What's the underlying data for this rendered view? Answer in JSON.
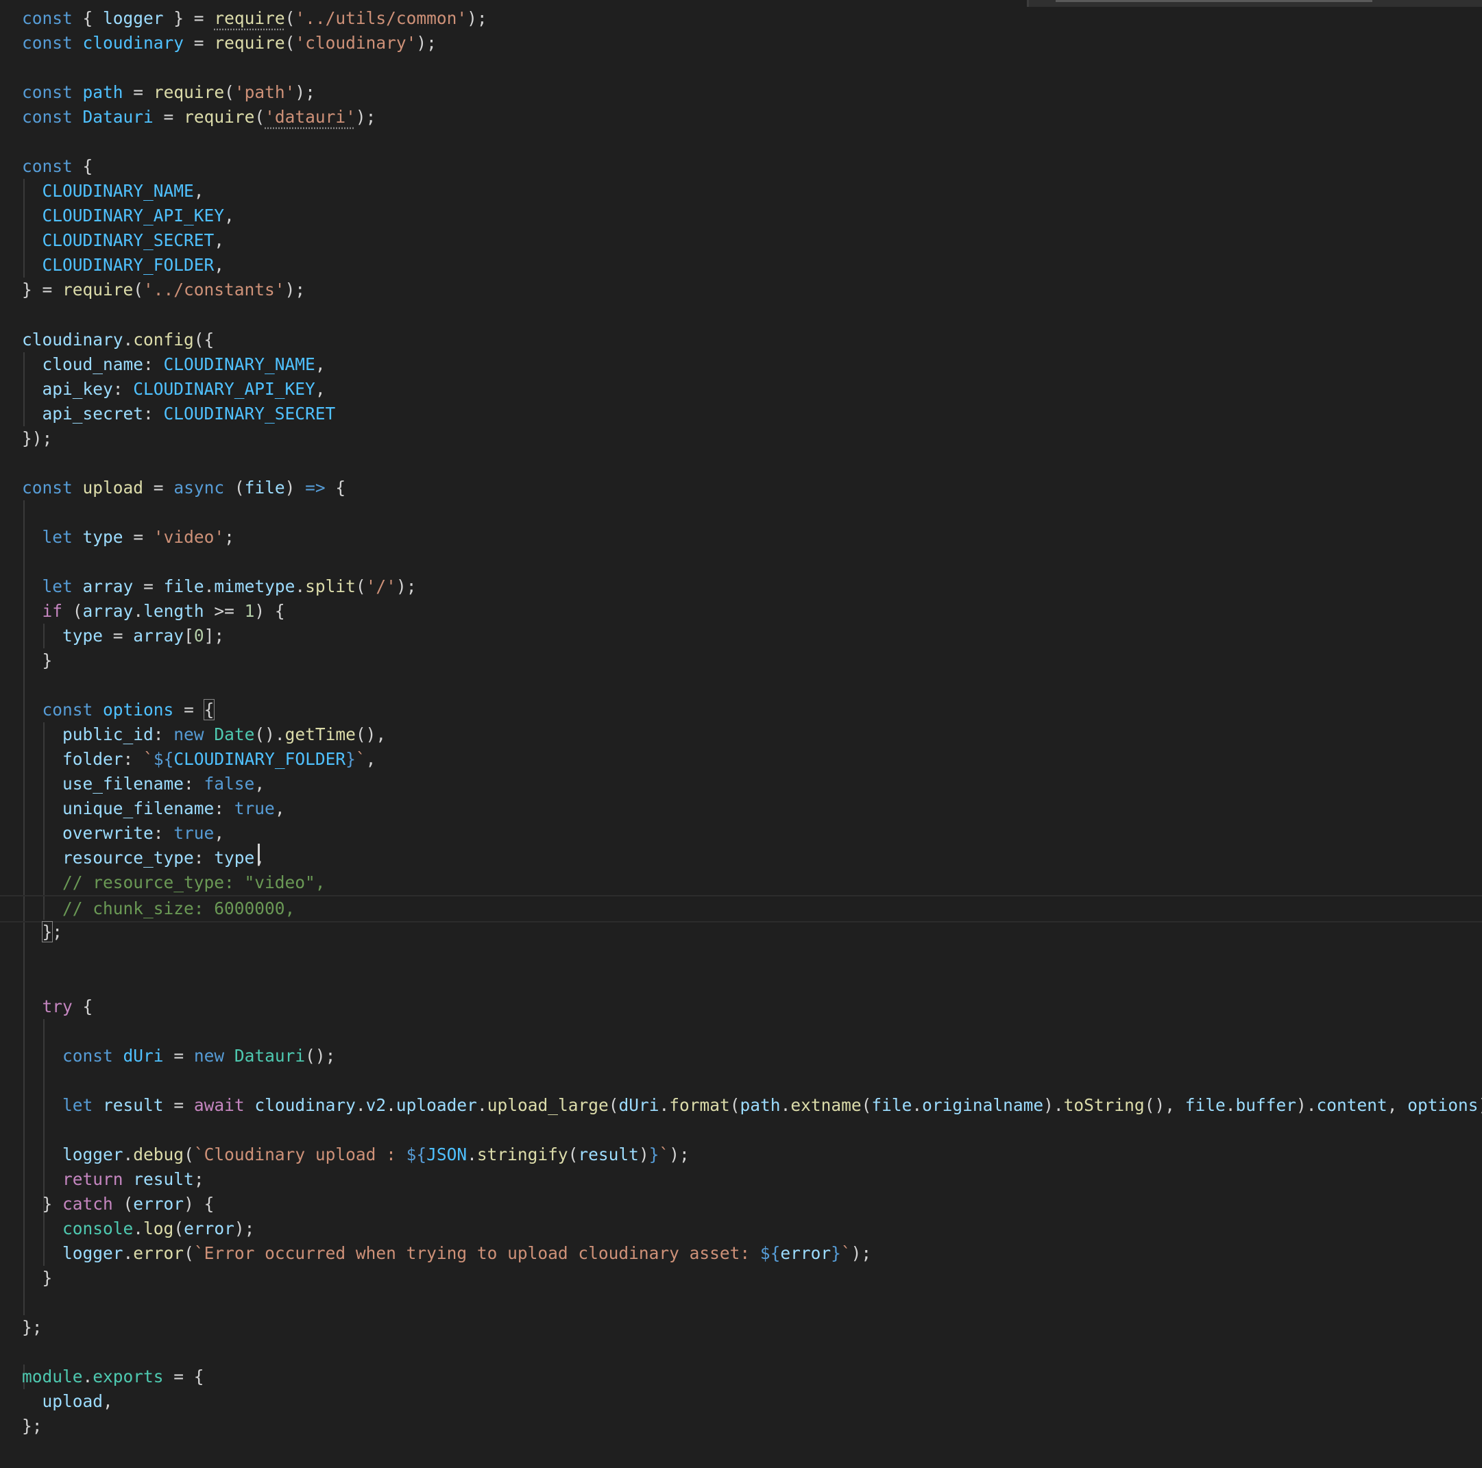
{
  "editor": {
    "language": "javascript",
    "theme_colors": {
      "background": "#1f1f1f",
      "keyword": "#569cd6",
      "control": "#c586c0",
      "function": "#dcdcaa",
      "string": "#ce9178",
      "variable": "#9cdcfe",
      "constant": "#4fc1ff",
      "number": "#b5cea8",
      "type": "#4ec9b0",
      "comment": "#6a9955"
    },
    "cursor": {
      "line": 36,
      "column": 27
    },
    "lines": [
      [
        [
          "kw",
          "const"
        ],
        [
          "pun",
          " { "
        ],
        [
          "var",
          "logger"
        ],
        [
          "pun",
          " } = "
        ],
        [
          "fn",
          "require",
          "dots"
        ],
        [
          "pun",
          "("
        ],
        [
          "str",
          "'../utils/common'"
        ],
        [
          "pun",
          ");"
        ]
      ],
      [
        [
          "kw",
          "const"
        ],
        [
          "pun",
          " "
        ],
        [
          "const",
          "cloudinary"
        ],
        [
          "pun",
          " = "
        ],
        [
          "fn",
          "require"
        ],
        [
          "pun",
          "("
        ],
        [
          "str",
          "'cloudinary'"
        ],
        [
          "pun",
          ");"
        ]
      ],
      [],
      [
        [
          "kw",
          "const"
        ],
        [
          "pun",
          " "
        ],
        [
          "const",
          "path"
        ],
        [
          "pun",
          " = "
        ],
        [
          "fn",
          "require"
        ],
        [
          "pun",
          "("
        ],
        [
          "str",
          "'path'"
        ],
        [
          "pun",
          ");"
        ]
      ],
      [
        [
          "kw",
          "const"
        ],
        [
          "pun",
          " "
        ],
        [
          "const",
          "Datauri"
        ],
        [
          "pun",
          " = "
        ],
        [
          "fn",
          "require"
        ],
        [
          "pun",
          "("
        ],
        [
          "str",
          "'datauri'",
          "dots"
        ],
        [
          "pun",
          ");"
        ]
      ],
      [],
      [
        [
          "kw",
          "const"
        ],
        [
          "pun",
          " {"
        ]
      ],
      [
        [
          "pun",
          "  "
        ],
        [
          "const",
          "CLOUDINARY_NAME"
        ],
        [
          "pun",
          ","
        ]
      ],
      [
        [
          "pun",
          "  "
        ],
        [
          "const",
          "CLOUDINARY_API_KEY"
        ],
        [
          "pun",
          ","
        ]
      ],
      [
        [
          "pun",
          "  "
        ],
        [
          "const",
          "CLOUDINARY_SECRET"
        ],
        [
          "pun",
          ","
        ]
      ],
      [
        [
          "pun",
          "  "
        ],
        [
          "const",
          "CLOUDINARY_FOLDER"
        ],
        [
          "pun",
          ","
        ]
      ],
      [
        [
          "pun",
          "} = "
        ],
        [
          "fn",
          "require"
        ],
        [
          "pun",
          "("
        ],
        [
          "str",
          "'../constants'"
        ],
        [
          "pun",
          ");"
        ]
      ],
      [],
      [
        [
          "var",
          "cloudinary"
        ],
        [
          "pun",
          "."
        ],
        [
          "fn",
          "config"
        ],
        [
          "pun",
          "({"
        ]
      ],
      [
        [
          "pun",
          "  "
        ],
        [
          "var",
          "cloud_name"
        ],
        [
          "pun",
          ": "
        ],
        [
          "const",
          "CLOUDINARY_NAME"
        ],
        [
          "pun",
          ","
        ]
      ],
      [
        [
          "pun",
          "  "
        ],
        [
          "var",
          "api_key"
        ],
        [
          "pun",
          ": "
        ],
        [
          "const",
          "CLOUDINARY_API_KEY"
        ],
        [
          "pun",
          ","
        ]
      ],
      [
        [
          "pun",
          "  "
        ],
        [
          "var",
          "api_secret"
        ],
        [
          "pun",
          ": "
        ],
        [
          "const",
          "CLOUDINARY_SECRET"
        ]
      ],
      [
        [
          "pun",
          "});"
        ]
      ],
      [],
      [
        [
          "kw",
          "const"
        ],
        [
          "pun",
          " "
        ],
        [
          "fn",
          "upload"
        ],
        [
          "pun",
          " = "
        ],
        [
          "kw",
          "async"
        ],
        [
          "pun",
          " ("
        ],
        [
          "var",
          "file"
        ],
        [
          "pun",
          ") "
        ],
        [
          "kw",
          "=>"
        ],
        [
          "pun",
          " {"
        ]
      ],
      [],
      [
        [
          "pun",
          "  "
        ],
        [
          "kw",
          "let"
        ],
        [
          "pun",
          " "
        ],
        [
          "var",
          "type"
        ],
        [
          "pun",
          " = "
        ],
        [
          "str",
          "'video'"
        ],
        [
          "pun",
          ";"
        ]
      ],
      [],
      [
        [
          "pun",
          "  "
        ],
        [
          "kw",
          "let"
        ],
        [
          "pun",
          " "
        ],
        [
          "var",
          "array"
        ],
        [
          "pun",
          " = "
        ],
        [
          "var",
          "file"
        ],
        [
          "pun",
          "."
        ],
        [
          "var",
          "mimetype"
        ],
        [
          "pun",
          "."
        ],
        [
          "fn",
          "split"
        ],
        [
          "pun",
          "("
        ],
        [
          "str",
          "'/'"
        ],
        [
          "pun",
          ");"
        ]
      ],
      [
        [
          "pun",
          "  "
        ],
        [
          "ctl",
          "if"
        ],
        [
          "pun",
          " ("
        ],
        [
          "var",
          "array"
        ],
        [
          "pun",
          "."
        ],
        [
          "var",
          "length"
        ],
        [
          "pun",
          " >= "
        ],
        [
          "num",
          "1"
        ],
        [
          "pun",
          ") {"
        ]
      ],
      [
        [
          "pun",
          "    "
        ],
        [
          "var",
          "type"
        ],
        [
          "pun",
          " = "
        ],
        [
          "var",
          "array"
        ],
        [
          "pun",
          "["
        ],
        [
          "num",
          "0"
        ],
        [
          "pun",
          "];"
        ]
      ],
      [
        [
          "pun",
          "  }"
        ]
      ],
      [],
      [
        [
          "pun",
          "  "
        ],
        [
          "kw",
          "const"
        ],
        [
          "pun",
          " "
        ],
        [
          "const",
          "options"
        ],
        [
          "pun",
          " = "
        ],
        [
          "pun",
          "{",
          "box"
        ]
      ],
      [
        [
          "pun",
          "    "
        ],
        [
          "var",
          "public_id"
        ],
        [
          "pun",
          ": "
        ],
        [
          "kw",
          "new"
        ],
        [
          "pun",
          " "
        ],
        [
          "type",
          "Date"
        ],
        [
          "pun",
          "()."
        ],
        [
          "fn",
          "getTime"
        ],
        [
          "pun",
          "(),"
        ]
      ],
      [
        [
          "pun",
          "    "
        ],
        [
          "var",
          "folder"
        ],
        [
          "pun",
          ": "
        ],
        [
          "str",
          "`"
        ],
        [
          "kw",
          "${"
        ],
        [
          "const",
          "CLOUDINARY_FOLDER"
        ],
        [
          "kw",
          "}"
        ],
        [
          "str",
          "`"
        ],
        [
          "pun",
          ","
        ]
      ],
      [
        [
          "pun",
          "    "
        ],
        [
          "var",
          "use_filename"
        ],
        [
          "pun",
          ": "
        ],
        [
          "kw",
          "false"
        ],
        [
          "pun",
          ","
        ]
      ],
      [
        [
          "pun",
          "    "
        ],
        [
          "var",
          "unique_filename"
        ],
        [
          "pun",
          ": "
        ],
        [
          "kw",
          "true"
        ],
        [
          "pun",
          ","
        ]
      ],
      [
        [
          "pun",
          "    "
        ],
        [
          "var",
          "overwrite"
        ],
        [
          "pun",
          ": "
        ],
        [
          "kw",
          "true"
        ],
        [
          "pun",
          ","
        ]
      ],
      [
        [
          "pun",
          "    "
        ],
        [
          "var",
          "resource_type"
        ],
        [
          "pun",
          ": "
        ],
        [
          "var",
          "type"
        ],
        [
          "pun",
          ","
        ]
      ],
      [
        [
          "pun",
          "    "
        ],
        [
          "com",
          "// resource_type: \"video\","
        ]
      ],
      [
        [
          "pun",
          "    "
        ],
        [
          "com",
          "// chunk_size: 6000000,"
        ]
      ],
      [
        [
          "pun",
          "  "
        ],
        [
          "pun",
          "}",
          "box"
        ],
        [
          "pun",
          ";"
        ]
      ],
      [],
      [],
      [
        [
          "pun",
          "  "
        ],
        [
          "ctl",
          "try"
        ],
        [
          "pun",
          " {"
        ]
      ],
      [],
      [
        [
          "pun",
          "    "
        ],
        [
          "kw",
          "const"
        ],
        [
          "pun",
          " "
        ],
        [
          "const",
          "dUri"
        ],
        [
          "pun",
          " = "
        ],
        [
          "kw",
          "new"
        ],
        [
          "pun",
          " "
        ],
        [
          "type",
          "Datauri"
        ],
        [
          "pun",
          "();"
        ]
      ],
      [],
      [
        [
          "pun",
          "    "
        ],
        [
          "kw",
          "let"
        ],
        [
          "pun",
          " "
        ],
        [
          "var",
          "result"
        ],
        [
          "pun",
          " = "
        ],
        [
          "ctl",
          "await"
        ],
        [
          "pun",
          " "
        ],
        [
          "var",
          "cloudinary"
        ],
        [
          "pun",
          "."
        ],
        [
          "var",
          "v2"
        ],
        [
          "pun",
          "."
        ],
        [
          "var",
          "uploader"
        ],
        [
          "pun",
          "."
        ],
        [
          "fn",
          "upload_large"
        ],
        [
          "pun",
          "("
        ],
        [
          "var",
          "dUri"
        ],
        [
          "pun",
          "."
        ],
        [
          "fn",
          "format"
        ],
        [
          "pun",
          "("
        ],
        [
          "var",
          "path"
        ],
        [
          "pun",
          "."
        ],
        [
          "fn",
          "extname"
        ],
        [
          "pun",
          "("
        ],
        [
          "var",
          "file"
        ],
        [
          "pun",
          "."
        ],
        [
          "var",
          "originalname"
        ],
        [
          "pun",
          ")."
        ],
        [
          "fn",
          "toString"
        ],
        [
          "pun",
          "(), "
        ],
        [
          "var",
          "file"
        ],
        [
          "pun",
          "."
        ],
        [
          "var",
          "buffer"
        ],
        [
          "pun",
          ")."
        ],
        [
          "var",
          "content"
        ],
        [
          "pun",
          ", "
        ],
        [
          "var",
          "options"
        ],
        [
          "pun",
          ");"
        ]
      ],
      [],
      [
        [
          "pun",
          "    "
        ],
        [
          "var",
          "logger"
        ],
        [
          "pun",
          "."
        ],
        [
          "fn",
          "debug"
        ],
        [
          "pun",
          "("
        ],
        [
          "str",
          "`Cloudinary upload : "
        ],
        [
          "kw",
          "${"
        ],
        [
          "const",
          "JSON"
        ],
        [
          "pun",
          "."
        ],
        [
          "fn",
          "stringify"
        ],
        [
          "pun",
          "("
        ],
        [
          "var",
          "result"
        ],
        [
          "pun",
          ")"
        ],
        [
          "kw",
          "}"
        ],
        [
          "str",
          "`"
        ],
        [
          "pun",
          ");"
        ]
      ],
      [
        [
          "pun",
          "    "
        ],
        [
          "ctl",
          "return"
        ],
        [
          "pun",
          " "
        ],
        [
          "var",
          "result"
        ],
        [
          "pun",
          ";"
        ]
      ],
      [
        [
          "pun",
          "  } "
        ],
        [
          "ctl",
          "catch"
        ],
        [
          "pun",
          " ("
        ],
        [
          "var",
          "error"
        ],
        [
          "pun",
          ") {"
        ]
      ],
      [
        [
          "pun",
          "    "
        ],
        [
          "type",
          "console"
        ],
        [
          "pun",
          "."
        ],
        [
          "fn",
          "log"
        ],
        [
          "pun",
          "("
        ],
        [
          "var",
          "error"
        ],
        [
          "pun",
          ");"
        ]
      ],
      [
        [
          "pun",
          "    "
        ],
        [
          "var",
          "logger"
        ],
        [
          "pun",
          "."
        ],
        [
          "fn",
          "error"
        ],
        [
          "pun",
          "("
        ],
        [
          "str",
          "`Error occurred when trying to upload cloudinary asset: "
        ],
        [
          "kw",
          "${"
        ],
        [
          "var",
          "error"
        ],
        [
          "kw",
          "}"
        ],
        [
          "str",
          "`"
        ],
        [
          "pun",
          ");"
        ]
      ],
      [
        [
          "pun",
          "  }"
        ]
      ],
      [],
      [
        [
          "pun",
          "};"
        ]
      ],
      [],
      [
        [
          "type",
          "module"
        ],
        [
          "pun",
          "."
        ],
        [
          "type",
          "exports"
        ],
        [
          "pun",
          " = {"
        ]
      ],
      [
        [
          "pun",
          "  "
        ],
        [
          "var",
          "upload"
        ],
        [
          "pun",
          ","
        ]
      ],
      [
        [
          "pun",
          "};"
        ]
      ]
    ]
  }
}
